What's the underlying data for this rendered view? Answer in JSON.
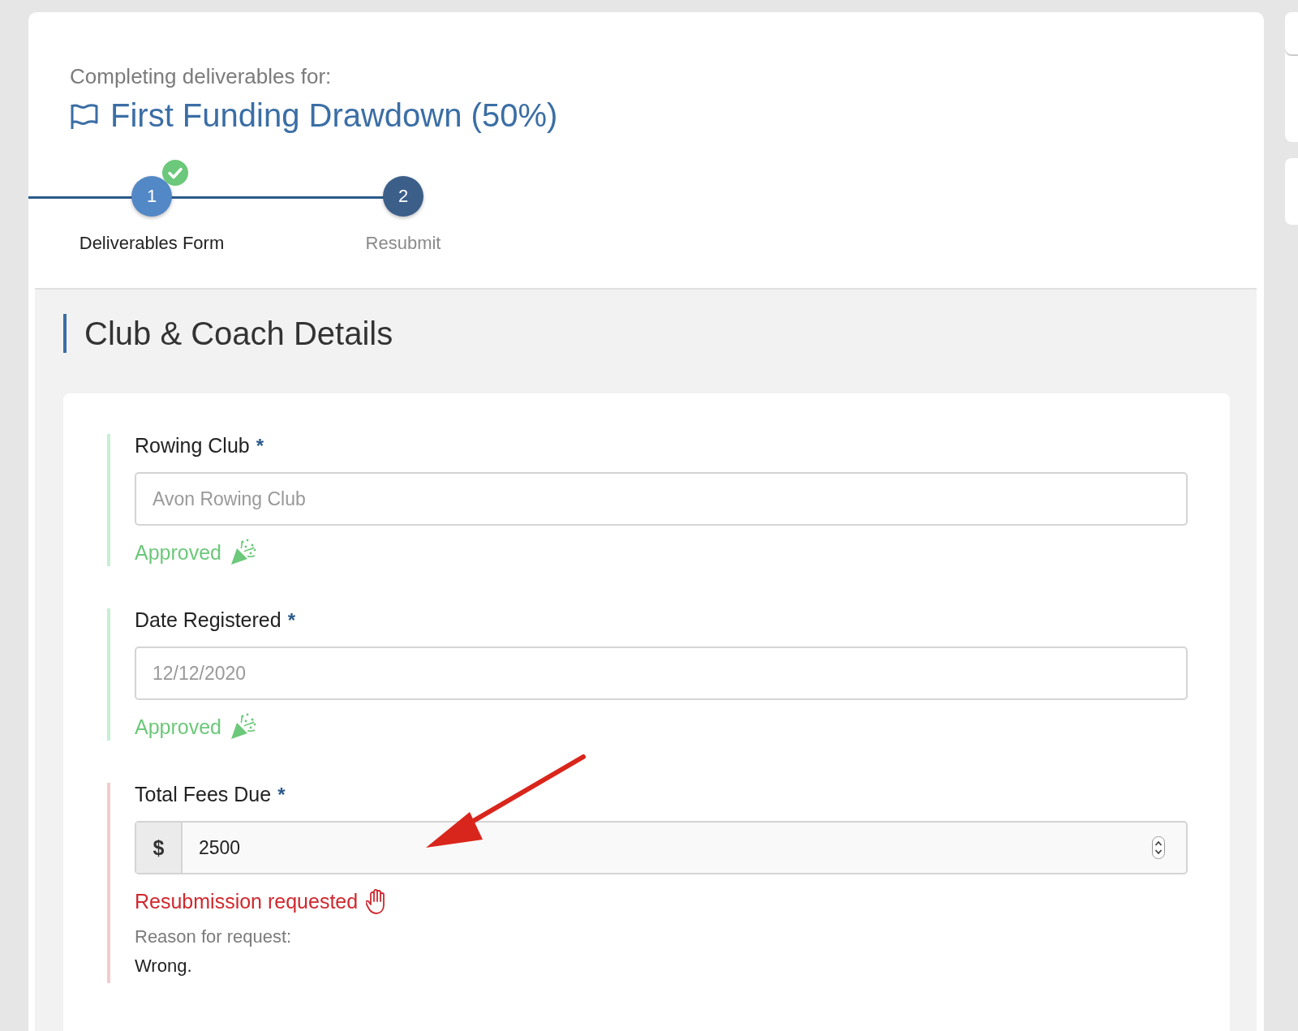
{
  "header": {
    "subtitle": "Completing deliverables for:",
    "title": "First Funding Drawdown (50%)"
  },
  "steps": [
    {
      "number": "1",
      "label": "Deliverables Form",
      "completed": true
    },
    {
      "number": "2",
      "label": "Resubmit",
      "completed": false
    }
  ],
  "section": {
    "title": "Club & Coach Details"
  },
  "fields": [
    {
      "label": "Rowing Club",
      "required": "*",
      "value": "Avon Rowing Club",
      "disabled": true,
      "kind": "approved",
      "status_text": "Approved"
    },
    {
      "label": "Date Registered",
      "required": "*",
      "value": "12/12/2020",
      "disabled": true,
      "kind": "approved",
      "status_text": "Approved"
    },
    {
      "label": "Total Fees Due",
      "required": "*",
      "prefix": "$",
      "value": "2500",
      "disabled": false,
      "kind": "resubmission",
      "status_text": "Resubmission requested",
      "reason_label": "Reason for request:",
      "reason": "Wrong."
    }
  ]
}
